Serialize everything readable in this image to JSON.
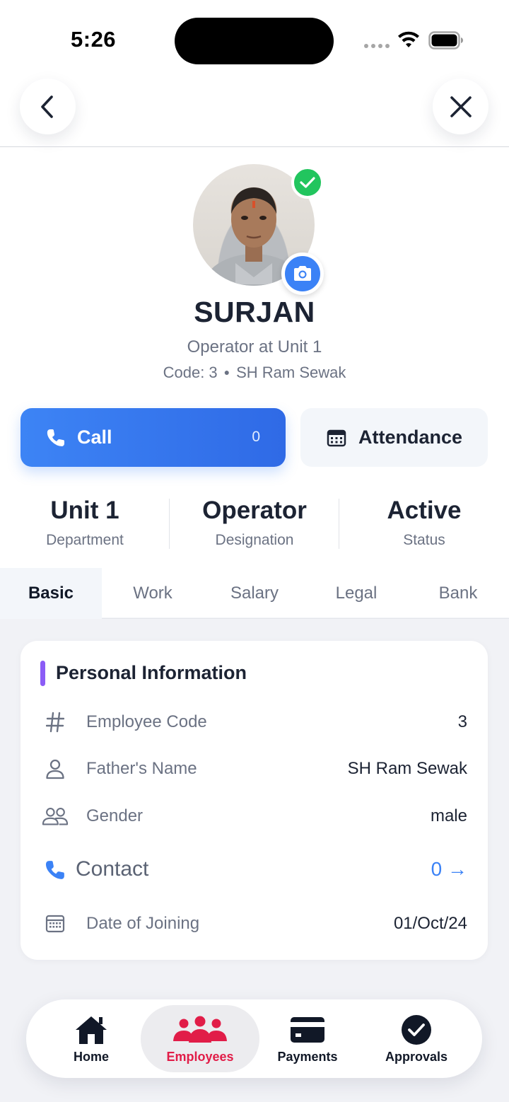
{
  "status_bar": {
    "time": "5:26"
  },
  "header": {
    "back_icon": "chevron-left-icon",
    "close_icon": "close-icon"
  },
  "profile": {
    "name": "SURJAN",
    "role": "Operator at Unit 1",
    "code": "Code: 3",
    "father": "SH Ram Sewak",
    "verified": true
  },
  "actions": {
    "call_label": "Call",
    "call_count": "0",
    "attendance_label": "Attendance"
  },
  "stats": [
    {
      "value": "Unit 1",
      "label": "Department"
    },
    {
      "value": "Operator",
      "label": "Designation"
    },
    {
      "value": "Active",
      "label": "Status"
    }
  ],
  "tabs": [
    "Basic",
    "Work",
    "Salary",
    "Legal",
    "Bank"
  ],
  "active_tab": "Basic",
  "personal_info": {
    "title": "Personal Information",
    "rows": [
      {
        "icon": "hash-icon",
        "label": "Employee Code",
        "value": "3"
      },
      {
        "icon": "person-icon",
        "label": "Father's Name",
        "value": "SH Ram Sewak"
      },
      {
        "icon": "people-icon",
        "label": "Gender",
        "value": "male"
      },
      {
        "icon": "phone-icon",
        "label": "Contact",
        "value": "0 →"
      },
      {
        "icon": "calendar-icon",
        "label": "Date of Joining",
        "value": "01/Oct/24"
      }
    ]
  },
  "bottom_nav": [
    {
      "label": "Home",
      "icon": "home-icon"
    },
    {
      "label": "Employees",
      "icon": "group-icon",
      "active": true
    },
    {
      "label": "Payments",
      "icon": "card-icon"
    },
    {
      "label": "Approvals",
      "icon": "check-circle-icon"
    }
  ],
  "colors": {
    "primary": "#3b82f6",
    "accent_purple": "#8b5cf6",
    "active_nav": "#e11d48",
    "verified": "#22c55e"
  }
}
